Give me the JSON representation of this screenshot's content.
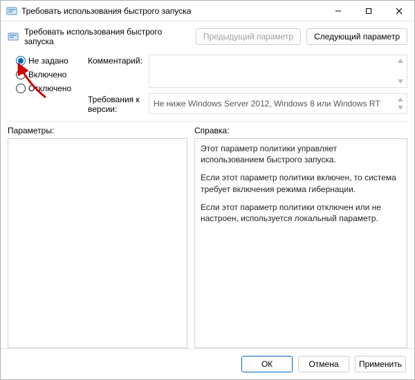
{
  "titlebar": {
    "text": "Требовать использования быстрого запуска"
  },
  "header": {
    "title": "Требовать использования быстрого запуска",
    "prev": "Предыдущий параметр",
    "next": "Следующий параметр"
  },
  "state": {
    "options": {
      "not_configured": "Не задано",
      "enabled": "Включено",
      "disabled": "Отключено"
    },
    "selected": "not_configured"
  },
  "fields": {
    "comment_label": "Комментарий:",
    "comment_value": "",
    "version_label": "Требования к версии:",
    "version_value": "Не ниже Windows Server 2012, Windows 8 или Windows RT"
  },
  "mid": {
    "params_label": "Параметры:",
    "help_label": "Справка:"
  },
  "help": {
    "p1": "Этот параметр политики управляет использованием быстрого запуска.",
    "p2": "Если этот параметр политики включен, то система требует включения режима гибернации.",
    "p3": "Если этот параметр политики отключен или не настроен, используется локальный параметр."
  },
  "footer": {
    "ok": "ОК",
    "cancel": "Отмена",
    "apply": "Применить"
  }
}
